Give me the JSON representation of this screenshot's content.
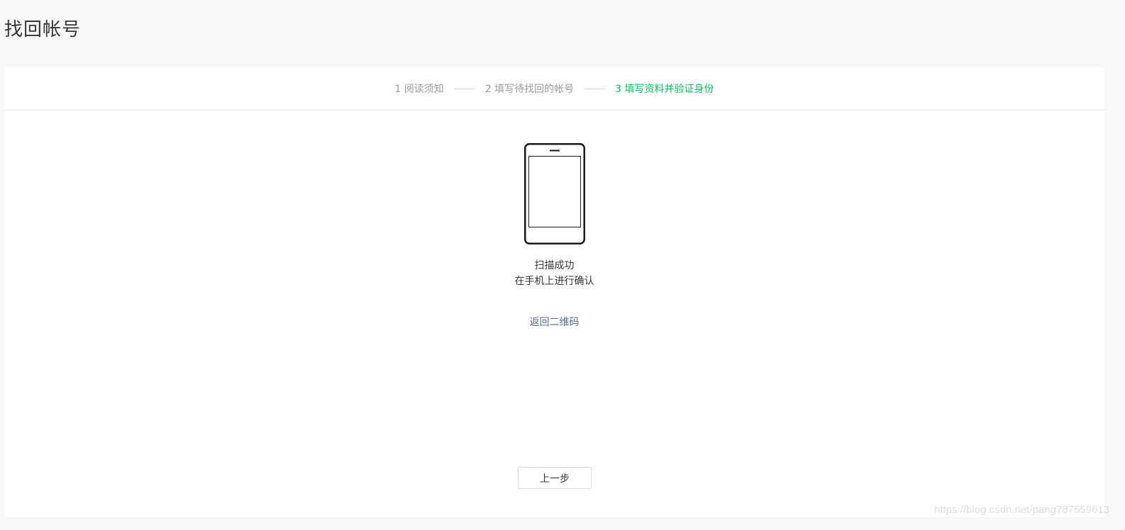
{
  "page": {
    "title": "找回帐号"
  },
  "steps": [
    {
      "label": "1 阅读须知",
      "active": false
    },
    {
      "label": "2 填写待找回的帐号",
      "active": false
    },
    {
      "label": "3 填写资料并验证身份",
      "active": true
    }
  ],
  "status": {
    "icon": "phone-icon",
    "line1": "扫描成功",
    "line2": "在手机上进行确认"
  },
  "links": {
    "back_to_qr": "返回二维码"
  },
  "footer": {
    "prev_label": "上一步"
  },
  "watermark": "https://blog.csdn.net/pang787559613",
  "colors": {
    "active_step": "#07c160",
    "link": "#576b95",
    "text": "#353535",
    "muted": "#9a9a9a",
    "background": "#f7f8fa"
  }
}
